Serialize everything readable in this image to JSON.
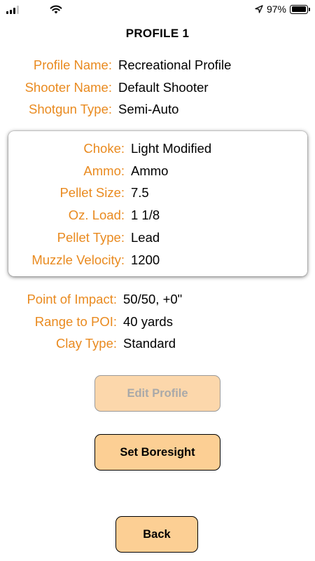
{
  "status_bar": {
    "battery_percent": "97%",
    "battery_level": 0.97
  },
  "title": "PROFILE 1",
  "profile": [
    {
      "label": "Profile Name:",
      "value": "Recreational Profile"
    },
    {
      "label": "Shooter Name:",
      "value": "Default Shooter"
    },
    {
      "label": "Shotgun Type:",
      "value": "Semi-Auto"
    }
  ],
  "ammo_card": [
    {
      "label": "Choke:",
      "value": "Light Modified"
    },
    {
      "label": "Ammo:",
      "value": "Ammo"
    },
    {
      "label": "Pellet Size:",
      "value": "7.5"
    },
    {
      "label": "Oz. Load:",
      "value": "1 1/8"
    },
    {
      "label": "Pellet Type:",
      "value": "Lead"
    },
    {
      "label": "Muzzle Velocity:",
      "value": "1200"
    }
  ],
  "impact": [
    {
      "label": "Point of Impact:",
      "value": "50/50, +0\""
    },
    {
      "label": "Range to POI:",
      "value": "40 yards"
    },
    {
      "label": "Clay Type:",
      "value": "Standard"
    }
  ],
  "buttons": {
    "edit_profile": "Edit Profile",
    "set_boresight": "Set Boresight",
    "back": "Back"
  },
  "colors": {
    "label_orange": "#e98a1f",
    "button_fill": "#fccf94",
    "button_disabled_fill": "#fcd7ab"
  }
}
